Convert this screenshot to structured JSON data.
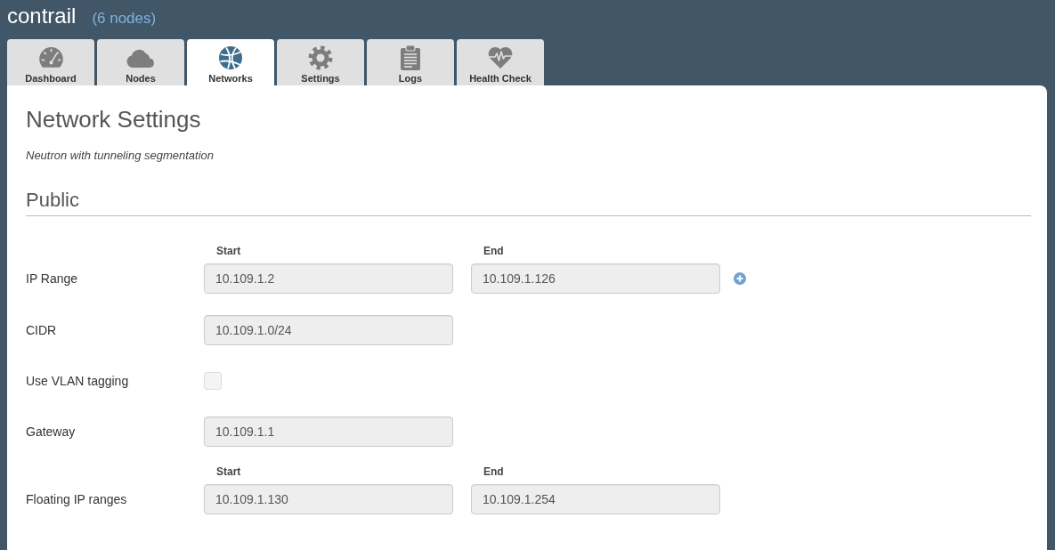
{
  "header": {
    "title": "contrail",
    "node_count": "(6 nodes)"
  },
  "tabs": [
    {
      "label": "Dashboard",
      "selected": false
    },
    {
      "label": "Nodes",
      "selected": false
    },
    {
      "label": "Networks",
      "selected": true
    },
    {
      "label": "Settings",
      "selected": false
    },
    {
      "label": "Logs",
      "selected": false
    },
    {
      "label": "Health Check",
      "selected": false
    }
  ],
  "page": {
    "title": "Network Settings",
    "subtitle": "Neutron with tunneling segmentation"
  },
  "sections": [
    {
      "title": "Public",
      "rows": [
        {
          "kind": "range",
          "label": "IP Range",
          "addable": true,
          "fields": [
            {
              "heading": "Start",
              "value": "10.109.1.2",
              "disabled": true
            },
            {
              "heading": "End",
              "value": "10.109.1.126",
              "disabled": true
            }
          ]
        },
        {
          "kind": "text",
          "label": "CIDR",
          "value": "10.109.1.0/24",
          "disabled": true
        },
        {
          "kind": "checkbox",
          "label": "Use VLAN tagging",
          "checked": false,
          "disabled": true
        },
        {
          "kind": "text",
          "label": "Gateway",
          "value": "10.109.1.1",
          "disabled": true
        },
        {
          "kind": "range",
          "label": "Floating IP ranges",
          "fields": [
            {
              "heading": "Start",
              "value": "10.109.1.130",
              "disabled": true
            },
            {
              "heading": "End",
              "value": "10.109.1.254",
              "disabled": true
            }
          ]
        }
      ]
    }
  ]
}
